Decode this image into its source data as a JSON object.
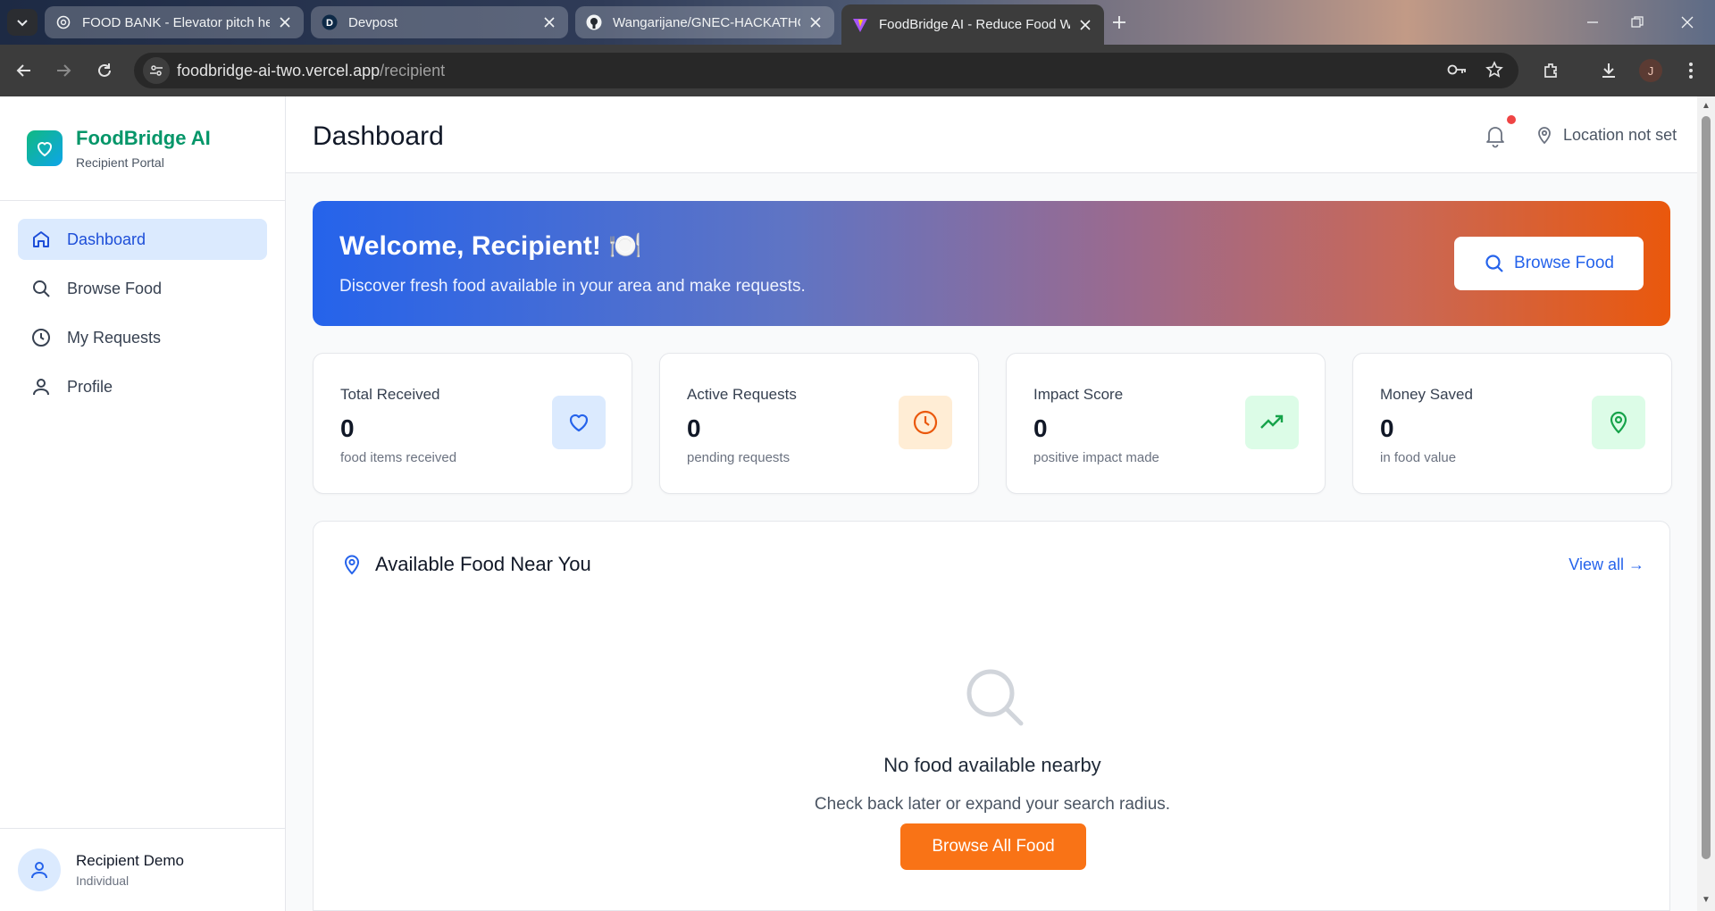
{
  "browser": {
    "tabs": [
      {
        "title": "FOOD BANK - Elevator pitch he",
        "favicon": "openai-icon"
      },
      {
        "title": "Devpost",
        "favicon": "devpost-icon"
      },
      {
        "title": "Wangarijane/GNEC-HACKATHO",
        "favicon": "github-icon"
      },
      {
        "title": "FoodBridge AI - Reduce Food W",
        "favicon": "vite-icon"
      }
    ],
    "url_host": "foodbridge-ai-two.vercel.app",
    "url_path": "/recipient",
    "profile_initial": "J"
  },
  "brand": {
    "name": "FoodBridge AI",
    "subtitle": "Recipient Portal"
  },
  "nav": {
    "items": [
      {
        "label": "Dashboard",
        "icon": "home-icon",
        "active": true
      },
      {
        "label": "Browse Food",
        "icon": "search-icon",
        "active": false
      },
      {
        "label": "My Requests",
        "icon": "clock-icon",
        "active": false
      },
      {
        "label": "Profile",
        "icon": "user-icon",
        "active": false
      }
    ]
  },
  "user": {
    "name": "Recipient Demo",
    "role": "Individual"
  },
  "header": {
    "title": "Dashboard",
    "location": "Location not set",
    "notification_dot_color": "#ef4444"
  },
  "hero": {
    "title": "Welcome, Recipient! 🍽️",
    "subtitle": "Discover fresh food available in your area and make requests.",
    "button": "Browse Food"
  },
  "stats": [
    {
      "label": "Total Received",
      "value": "0",
      "sub": "food items received",
      "icon": "heart-icon",
      "color": "#2563eb",
      "bg": "#dbeafe"
    },
    {
      "label": "Active Requests",
      "value": "0",
      "sub": "pending requests",
      "icon": "clock-icon",
      "color": "#ea580c",
      "bg": "#ffedd5"
    },
    {
      "label": "Impact Score",
      "value": "0",
      "sub": "positive impact made",
      "icon": "trending-up-icon",
      "color": "#16a34a",
      "bg": "#dcfce7"
    },
    {
      "label": "Money Saved",
      "value": "0",
      "sub": "in food value",
      "icon": "map-pin-icon",
      "color": "#16a34a",
      "bg": "#dcfce7"
    }
  ],
  "available": {
    "title": "Available Food Near You",
    "view_all": "View all →",
    "empty_title": "No food available nearby",
    "empty_sub": "Check back later or expand your search radius.",
    "cta": "Browse All Food"
  },
  "colors": {
    "accent": "#2563eb",
    "brand": "#059669",
    "cta": "#f97316"
  }
}
